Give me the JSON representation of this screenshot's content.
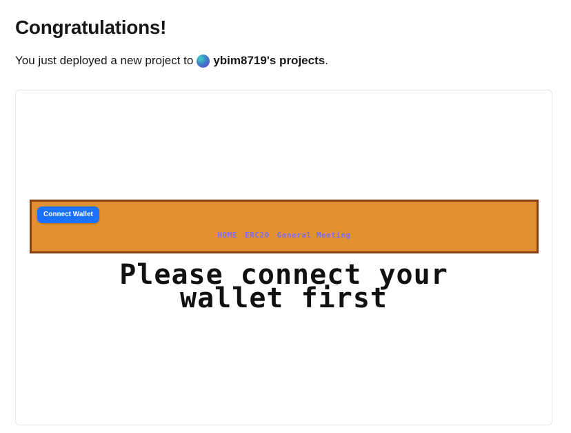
{
  "heading": "Congratulations!",
  "subtitle": {
    "prefix": "You just deployed a new project to",
    "team": "ybim8719's projects",
    "suffix": "."
  },
  "preview": {
    "connect_button": "Connect Wallet",
    "nav": {
      "home": "HOME",
      "erc20": "ERC20",
      "general_meeting": "General Meeting"
    },
    "message_line1": "Please connect your",
    "message_line2": "wallet first"
  },
  "colors": {
    "header_bg": "#e29130",
    "header_border": "#8a4010",
    "button": "#1a72ff",
    "nav_link": "#7e6cf2"
  }
}
